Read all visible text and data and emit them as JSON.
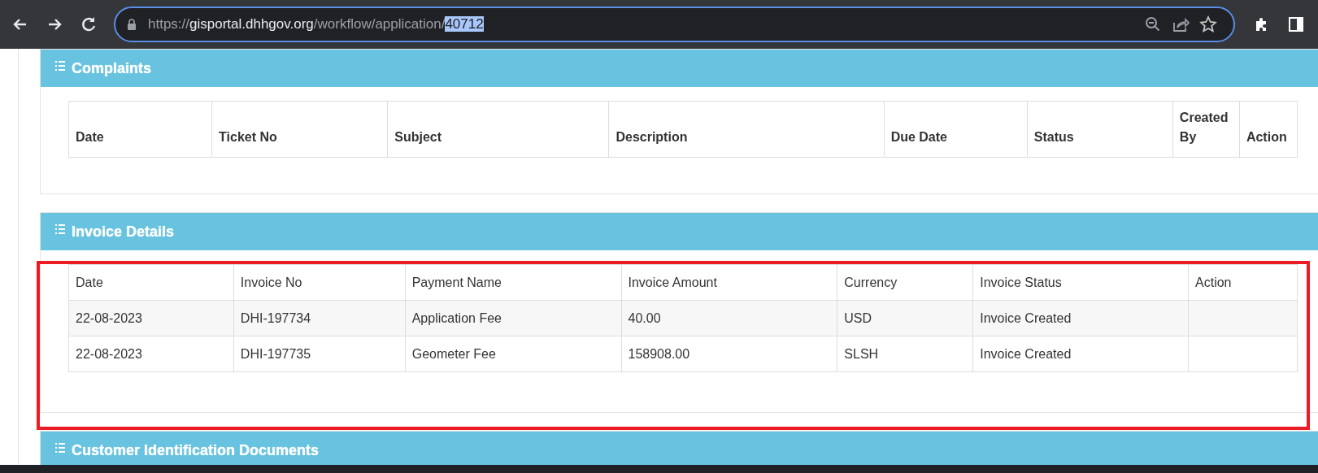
{
  "browser": {
    "address": {
      "scheme": "https://",
      "host": "gisportal.dhhgov.org",
      "path": "/workflow/application/",
      "selected_text": "40712"
    }
  },
  "panels": [
    {
      "title": "Complaints",
      "table": {
        "header_bold": true,
        "columns": [
          "Date",
          "Ticket No",
          "Subject",
          "Description",
          "Due Date",
          "Status",
          "Created By",
          "Action"
        ]
      }
    },
    {
      "title": "Invoice Details",
      "highlighted": true,
      "table": {
        "header_bold": false,
        "columns": [
          "Date",
          "Invoice No",
          "Payment Name",
          "Invoice Amount",
          "Currency",
          "Invoice Status",
          "Action"
        ],
        "rows": [
          [
            "22-08-2023",
            "DHI-197734",
            "Application Fee",
            "40.00",
            "USD",
            "Invoice Created",
            ""
          ],
          [
            "22-08-2023",
            "DHI-197735",
            "Geometer Fee",
            "158908.00",
            "SLSH",
            "Invoice Created",
            ""
          ]
        ]
      }
    },
    {
      "title": "Customer Identification Documents"
    }
  ],
  "annotation": {
    "kind": "rectangle",
    "color": "#ec1c24"
  }
}
